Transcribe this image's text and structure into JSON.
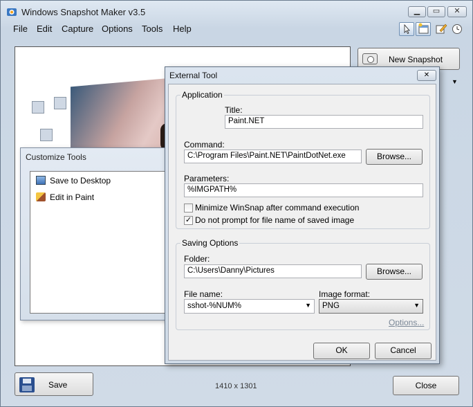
{
  "app": {
    "title": "Windows Snapshot Maker v3.5"
  },
  "menu": [
    "File",
    "Edit",
    "Capture",
    "Options",
    "Tools",
    "Help"
  ],
  "toolbar": {
    "icons": [
      "cursor-icon",
      "window-capture-icon",
      "edit-icon",
      "timer-icon"
    ]
  },
  "right_panel": {
    "new_snapshot_label": "New Snapshot"
  },
  "bottom": {
    "save_label": "Save",
    "dimensions": "1410 x 1301",
    "close_label": "Close"
  },
  "customize_tools": {
    "title": "Customize Tools",
    "items": [
      {
        "label": "Save to Desktop",
        "icon": "desktop-icon"
      },
      {
        "label": "Edit in Paint",
        "icon": "paint-icon"
      }
    ]
  },
  "external_tool": {
    "title": "External Tool",
    "application_group": "Application",
    "title_label": "Title:",
    "title_value": "Paint.NET",
    "command_label": "Command:",
    "command_value": "C:\\Program Files\\Paint.NET\\PaintDotNet.exe",
    "browse_label": "Browse...",
    "parameters_label": "Parameters:",
    "parameters_value": "%IMGPATH%",
    "minimize_label": "Minimize WinSnap after command execution",
    "minimize_checked": false,
    "no_prompt_label": "Do not prompt for file name of saved image",
    "no_prompt_checked": true,
    "saving_group": "Saving Options",
    "folder_label": "Folder:",
    "folder_value": "C:\\Users\\Danny\\Pictures",
    "file_name_label": "File name:",
    "file_name_value": "sshot-%NUM%",
    "image_format_label": "Image format:",
    "image_format_value": "PNG",
    "options_link": "Options...",
    "ok_label": "OK",
    "cancel_label": "Cancel"
  }
}
